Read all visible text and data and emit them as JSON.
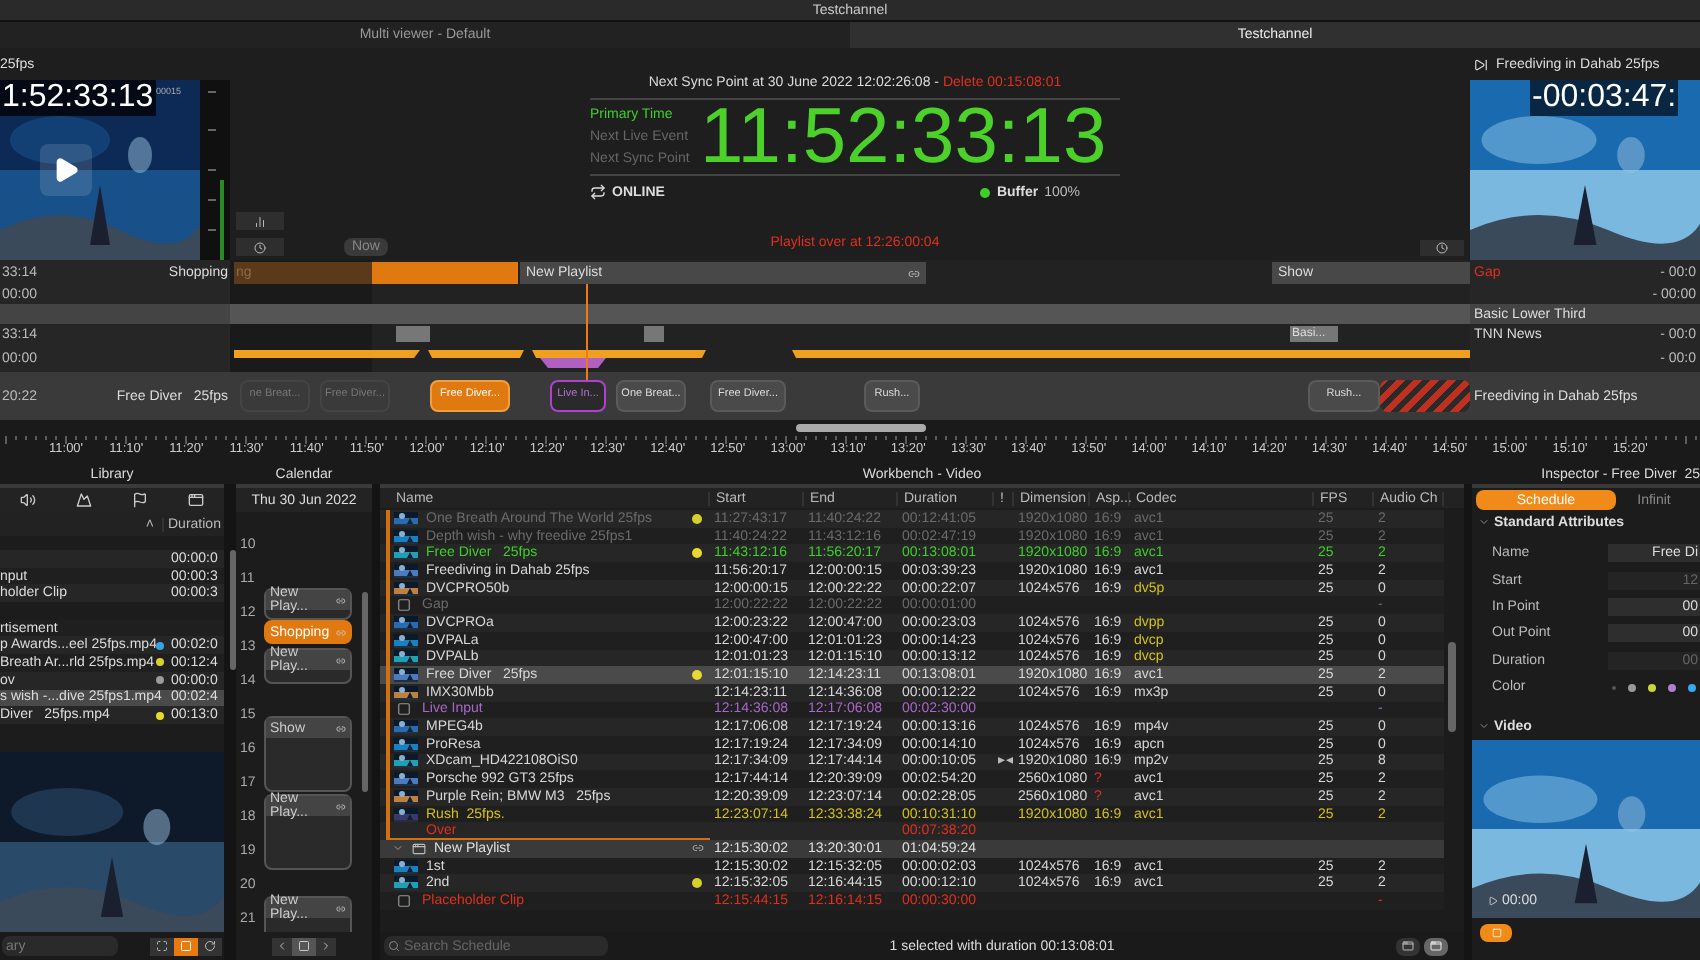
{
  "title_bar": {
    "title": "Testchannel"
  },
  "tabs": [
    {
      "label": "Multi viewer - Default",
      "selected": false
    },
    {
      "label": "Testchannel",
      "selected": true
    }
  ],
  "left_preview": {
    "title": "25fps",
    "timecode": "1:52:33:13",
    "counter": "00015"
  },
  "now_button": "Now",
  "clock": {
    "sync_heading": "Next Sync Point at 30 June 2022 12:02:26:08 -",
    "delete_text": "Delete 00:15:08:01",
    "modes": [
      {
        "label": "Primary Time",
        "selected": true
      },
      {
        "label": "Next Live Event",
        "selected": false
      },
      {
        "label": "Next Sync Point",
        "selected": false
      }
    ],
    "time": "11:52:33:13",
    "status": "ONLINE",
    "buffer_label": "Buffer",
    "buffer_value": "100%",
    "playlist_over": "Playlist over at 12:26:00:04"
  },
  "right_preview": {
    "title": "Freediving in Dahab 25fps",
    "timecode": "-00:03:47:"
  },
  "timeline": {
    "left_rows": [
      {
        "time": "33:14",
        "label": "Shopping"
      },
      {
        "time": "00:00"
      },
      {},
      {
        "time": "33:14"
      },
      {
        "time": "00:00"
      },
      {
        "time": "20:22",
        "label": "Free Diver   25fps"
      }
    ],
    "right_rows": [
      {
        "label": "Gap",
        "kind": "error",
        "time": "- 00:0"
      },
      {
        "time": "- 00:00"
      },
      {
        "label": "Basic Lower Third"
      },
      {
        "label": "TNN News",
        "time": "- 00:0"
      },
      {
        "time": "- 00:0"
      },
      {
        "label": "Freediving in Dahab 25fps"
      }
    ],
    "past_segment": "ng",
    "headers": [
      "New Playlist",
      "Show"
    ],
    "graphic_label": "Basi...",
    "clips": [
      {
        "label": "ne Breat...",
        "kind": "past"
      },
      {
        "label": "Free Diver...",
        "kind": "past"
      },
      {
        "label": "Free Diver...",
        "kind": "onair"
      },
      {
        "label": "Live In...",
        "kind": "live"
      },
      {
        "label": "One Breat...",
        "kind": "normal"
      },
      {
        "label": "Free Diver...",
        "kind": "normal"
      },
      {
        "label": "Rush...",
        "kind": "normal"
      },
      {
        "label": "Rush...",
        "kind": "normal"
      },
      {
        "kind": "blocked"
      }
    ],
    "ruler": [
      "11:00'",
      "11:10'",
      "11:20'",
      "11:30'",
      "11:40'",
      "11:50'",
      "12:00'",
      "12:10'",
      "12:20'",
      "12:30'",
      "12:40'",
      "12:50'",
      "13:00'",
      "13:10'",
      "13:20'",
      "13:30'",
      "13:40'",
      "13:50'",
      "14:00'",
      "14:10'",
      "14:20'",
      "14:30'",
      "14:40'",
      "14:50'",
      "15:00'",
      "15:10'",
      "15:20'"
    ]
  },
  "library": {
    "title": "Library",
    "duration_header": "Duration",
    "sort_mark": "˄",
    "rows": [
      {
        "duration": "00:00:0",
        "selected": false
      },
      {
        "name": "nput",
        "duration": "00:00:3",
        "selected": false
      },
      {
        "name": "holder Clip",
        "duration": "00:00:3",
        "selected": false
      },
      {
        "name": "rtisement",
        "kind": "folder",
        "selected": false
      },
      {
        "name": "p Awards...eel 25fps.mp4",
        "color": "#3aa0e8",
        "duration": "00:02:0",
        "selected": false
      },
      {
        "name": "Breath Ar...rld 25fps.mp4",
        "color": "#d8d02a",
        "duration": "00:12:4",
        "selected": false
      },
      {
        "name": "ov",
        "color": "#9a9a9a",
        "duration": "00:00:0",
        "selected": false
      },
      {
        "name": "s wish -...dive 25fps1.mp4",
        "duration": "00:02:4",
        "selected": true
      },
      {
        "name": "Diver   25fps.mp4",
        "color": "#e8d830",
        "duration": "00:13:0",
        "selected": false
      }
    ],
    "search_value": "ary"
  },
  "calendar": {
    "title": "Calendar",
    "date": "Thu 30 Jun 2022",
    "hours": [
      "10",
      "11",
      "12",
      "13",
      "14",
      "15",
      "16",
      "17",
      "18",
      "19",
      "20",
      "21"
    ],
    "entries": [
      {
        "label": "New Play...",
        "selected": false
      },
      {
        "label": "Shopping",
        "selected": true
      },
      {
        "label": "New Play...",
        "selected": false
      },
      {
        "label": "Show",
        "selected": false
      },
      {
        "label": "New Play...",
        "selected": false
      },
      {
        "label": "New Play...",
        "selected": false
      }
    ]
  },
  "workbench": {
    "title": "Workbench - Video",
    "columns": [
      "Name",
      "Start",
      "End",
      "Duration",
      "!",
      "Dimension",
      "Asp...",
      "Codec",
      "FPS",
      "Audio Ch"
    ],
    "sections": [
      {
        "active": true,
        "rows": [
          {
            "kind": "past",
            "name": "One Breath Around The World 25fps",
            "color": "#d8d02a",
            "start": "11:27:43:17",
            "end": "11:40:24:22",
            "duration": "00:12:41:05",
            "dimension": "1920x1080",
            "aspect": "16:9",
            "codec": "avc1",
            "fps": "25",
            "audio": "2",
            "selected": false
          },
          {
            "kind": "past",
            "name": "Depth wish - why freedive 25fps1",
            "start": "11:40:24:22",
            "end": "11:43:12:16",
            "duration": "00:02:47:19",
            "dimension": "1920x1080",
            "aspect": "16:9",
            "codec": "avc1",
            "fps": "25",
            "audio": "2",
            "selected": false
          },
          {
            "kind": "onair",
            "name": "Free Diver   25fps",
            "color": "#e8d830",
            "start": "11:43:12:16",
            "end": "11:56:20:17",
            "duration": "00:13:08:01",
            "dimension": "1920x1080",
            "aspect": "16:9",
            "codec": "avc1",
            "fps": "25",
            "audio": "2",
            "selected": false
          },
          {
            "kind": "normal",
            "name": "Freediving in Dahab 25fps",
            "start": "11:56:20:17",
            "end": "12:00:00:15",
            "duration": "00:03:39:23",
            "dimension": "1920x1080",
            "aspect": "16:9",
            "codec": "avc1",
            "fps": "25",
            "audio": "2",
            "selected": false
          },
          {
            "kind": "normal",
            "name": "DVCPRO50b",
            "start": "12:00:00:15",
            "end": "12:00:22:22",
            "duration": "00:00:22:07",
            "dimension": "1024x576",
            "aspect": "16:9",
            "codec": "dv5p",
            "codec_warning": true,
            "fps": "25",
            "audio": "0",
            "selected": false
          },
          {
            "kind": "gap",
            "name": "Gap",
            "start": "12:00:22:22",
            "end": "12:00:22:22",
            "duration": "00:00:01:00",
            "audio": "-",
            "selected": false
          },
          {
            "kind": "normal",
            "name": "DVCPROa",
            "start": "12:00:23:22",
            "end": "12:00:47:00",
            "duration": "00:00:23:03",
            "dimension": "1024x576",
            "aspect": "16:9",
            "codec": "dvpp",
            "codec_warning": true,
            "fps": "25",
            "audio": "0",
            "selected": false
          },
          {
            "kind": "normal",
            "name": "DVPALa",
            "start": "12:00:47:00",
            "end": "12:01:01:23",
            "duration": "00:00:14:23",
            "dimension": "1024x576",
            "aspect": "16:9",
            "codec": "dvcp",
            "codec_warning": true,
            "fps": "25",
            "audio": "0",
            "selected": false
          },
          {
            "kind": "normal",
            "name": "DVPALb",
            "start": "12:01:01:23",
            "end": "12:01:15:10",
            "duration": "00:00:13:12",
            "dimension": "1024x576",
            "aspect": "16:9",
            "codec": "dvcp",
            "codec_warning": true,
            "fps": "25",
            "audio": "0",
            "selected": false
          },
          {
            "kind": "normal",
            "name": "Free Diver   25fps",
            "color": "#e8d830",
            "start": "12:01:15:10",
            "end": "12:14:23:11",
            "duration": "00:13:08:01",
            "dimension": "1920x1080",
            "aspect": "16:9",
            "codec": "avc1",
            "fps": "25",
            "audio": "2",
            "selected": true
          },
          {
            "kind": "normal",
            "name": "IMX30Mbb",
            "start": "12:14:23:11",
            "end": "12:14:36:08",
            "duration": "00:00:12:22",
            "dimension": "1024x576",
            "aspect": "16:9",
            "codec": "mx3p",
            "fps": "25",
            "audio": "0",
            "selected": false
          },
          {
            "kind": "live",
            "name": "Live Input",
            "start": "12:14:36:08",
            "end": "12:17:06:08",
            "duration": "00:02:30:00",
            "audio": "-",
            "selected": false
          },
          {
            "kind": "normal",
            "name": "MPEG4b",
            "start": "12:17:06:08",
            "end": "12:17:19:24",
            "duration": "00:00:13:16",
            "dimension": "1024x576",
            "aspect": "16:9",
            "codec": "mp4v",
            "fps": "25",
            "audio": "0",
            "selected": false
          },
          {
            "kind": "normal",
            "name": "ProResa",
            "start": "12:17:19:24",
            "end": "12:17:34:09",
            "duration": "00:00:14:10",
            "dimension": "1024x576",
            "aspect": "16:9",
            "codec": "apcn",
            "fps": "25",
            "audio": "0",
            "selected": false
          },
          {
            "kind": "normal",
            "name": "XDcam_HD422108OiS0",
            "start": "12:17:34:09",
            "end": "12:17:44:14",
            "duration": "00:00:10:05",
            "flag": "▸◂",
            "dimension": "1920x1080",
            "aspect": "16:9",
            "codec": "mp2v",
            "fps": "25",
            "audio": "8",
            "selected": false
          },
          {
            "kind": "normal",
            "name": "Porsche 992 GT3 25fps",
            "start": "12:17:44:14",
            "end": "12:20:39:09",
            "duration": "00:02:54:20",
            "dimension": "2560x1080",
            "aspect": "?",
            "aspect_warning": true,
            "codec": "avc1",
            "fps": "25",
            "audio": "2",
            "selected": false
          },
          {
            "kind": "normal",
            "name": "Purple Rein; BMW M3   25fps",
            "start": "12:20:39:09",
            "end": "12:23:07:14",
            "duration": "00:02:28:05",
            "dimension": "2560x1080",
            "aspect": "?",
            "aspect_warning": true,
            "codec": "avc1",
            "fps": "25",
            "audio": "2",
            "selected": false
          },
          {
            "kind": "next",
            "name": "Rush  25fps.",
            "start": "12:23:07:14",
            "end": "12:33:38:24",
            "duration": "00:10:31:10",
            "dimension": "1920x1080",
            "aspect": "16:9",
            "codec": "avc1",
            "fps": "25",
            "audio": "2",
            "selected": false
          },
          {
            "kind": "over",
            "name": "Over",
            "duration": "00:07:38:20",
            "selected": false
          }
        ]
      },
      {
        "active": false,
        "header": {
          "name": "New Playlist",
          "start": "12:15:30:02",
          "end": "13:20:30:01",
          "duration": "01:04:59:24",
          "expanded": true
        },
        "rows": [
          {
            "kind": "normal",
            "name": "1st",
            "start": "12:15:30:02",
            "end": "12:15:32:05",
            "duration": "00:00:02:03",
            "dimension": "1024x576",
            "aspect": "16:9",
            "codec": "avc1",
            "fps": "25",
            "audio": "2",
            "selected": false
          },
          {
            "kind": "normal",
            "name": "2nd",
            "color": "#d8d02a",
            "start": "12:15:32:05",
            "end": "12:16:44:15",
            "duration": "00:00:12:10",
            "dimension": "1024x576",
            "aspect": "16:9",
            "codec": "avc1",
            "fps": "25",
            "audio": "2",
            "selected": false
          },
          {
            "kind": "placeholder",
            "name": "Placeholder Clip",
            "start": "12:15:44:15",
            "end": "12:16:14:15",
            "duration": "00:00:30:00",
            "audio": "-",
            "selected": false
          }
        ]
      }
    ],
    "search_placeholder": "Search Schedule",
    "status": "1 selected with duration 00:13:08:01"
  },
  "inspector": {
    "title": "Inspector - Free Diver  25",
    "tabs": [
      {
        "label": "Schedule",
        "selected": true
      },
      {
        "label": "Infinit",
        "selected": false
      }
    ],
    "section": "Standard Attributes",
    "fields": [
      {
        "label": "Name",
        "value": "Free Di",
        "editable": true
      },
      {
        "label": "Start",
        "value": "12",
        "editable": false
      },
      {
        "label": "In Point",
        "value": "00",
        "editable": true
      },
      {
        "label": "Out Point",
        "value": "00",
        "editable": true
      },
      {
        "label": "Duration",
        "value": "00",
        "editable": false
      }
    ],
    "color_label": "Color",
    "colors": [
      {
        "color": "#555555"
      },
      {
        "color": "#9a9a9a"
      },
      {
        "color": "#c8d838"
      },
      {
        "color": "#b080d0"
      },
      {
        "color": "#38a8f0"
      }
    ],
    "video_section": "Video",
    "video_time": "00:00"
  }
}
